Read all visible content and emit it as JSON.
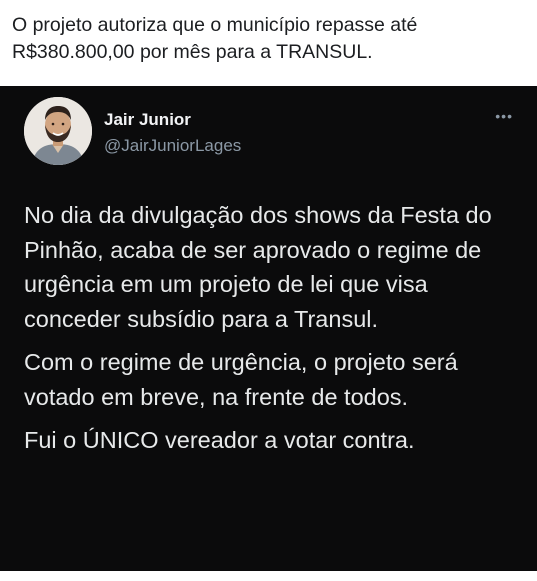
{
  "caption": "O projeto autoriza que o município repasse até R$380.800,00 por mês para a TRANSUL.",
  "tweet": {
    "author_name": "Jair Junior",
    "author_handle": "@JairJuniorLages",
    "more_icon": "more-options-icon",
    "paragraphs": [
      "No dia da divulgação dos shows da Festa do Pinhão, acaba de ser aprovado o regime de urgência em um projeto de lei que visa conceder subsídio para a Transul.",
      "Com o regime de urgência, o projeto será votado em breve, na frente de todos.",
      "Fui o ÚNICO vereador a votar contra."
    ]
  },
  "colors": {
    "tweet_background": "#0b0b0c",
    "tweet_text": "#e7e9ea",
    "handle_text": "#8b98a5",
    "caption_text": "#1c1e21"
  }
}
